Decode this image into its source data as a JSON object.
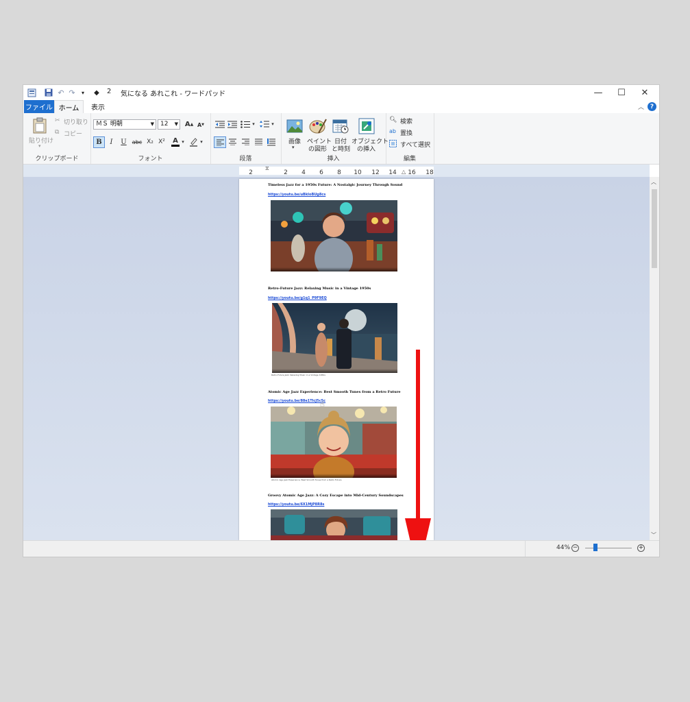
{
  "window": {
    "title_prefix": "2",
    "title": "気になる あれこれ - ワードパッド",
    "controls": {
      "minimize": "—",
      "maximize": "☐",
      "close": "✕"
    }
  },
  "tabs": [
    {
      "label": "ファイル"
    },
    {
      "label": "ホーム"
    },
    {
      "label": "表示"
    }
  ],
  "ribbon": {
    "clipboard": {
      "paste": "貼り付け",
      "cut": "切り取り",
      "copy": "コピー",
      "group": "クリップボード"
    },
    "font": {
      "family": "ＭＳ 明朝",
      "size": "12",
      "group": "フォント",
      "buttons": {
        "bold": "B",
        "italic": "I",
        "underline": "U",
        "strike": "abc",
        "subscript": "X₂",
        "superscript": "X²",
        "color": "A"
      }
    },
    "paragraph": {
      "group": "段落"
    },
    "insert": {
      "picture_l1": "画像",
      "paint_l1": "ペイント",
      "paint_l2": "の図形",
      "date_l1": "日付",
      "date_l2": "と時刻",
      "object_l1": "オブジェクト",
      "object_l2": "の挿入",
      "group": "挿入"
    },
    "edit": {
      "find": "検索",
      "replace": "置換",
      "select_all": "すべて選択",
      "group": "編集"
    }
  },
  "ruler": {
    "labels": [
      "2",
      "2",
      "4",
      "6",
      "8",
      "10",
      "12",
      "14",
      "16",
      "18"
    ]
  },
  "document": {
    "entries": [
      {
        "title": "Timeless Jazz for a 1950s Future: A Nostalgic Journey Through Sound",
        "link": "https://youtu.be/uBkIoBUg8cs",
        "caption": ""
      },
      {
        "title": "Retro-Future Jazz: Relaxing Music in a Vintage 1950s",
        "link": "https://youtu.be/g1q1_P9F9EQ",
        "caption": "Retro-Future Jazz: Relaxing Music in a Vintage 1950s"
      },
      {
        "title": "Atomic Age Jazz Experience: Best Smooth Tunes from a Retro Future",
        "link": "https://youtu.be/88e1TlcJ5c5c",
        "caption": "Atomic Age Jazz Experience: Best Smooth Tunes from a Retro Future"
      },
      {
        "title": "Groovy Atomic Age Jazz: A Cozy Escape into Mid-Century Soundscapes",
        "link": "https://youtu.be/6X1MjP8R8s",
        "caption": ""
      }
    ]
  },
  "status": {
    "zoom": "44%"
  },
  "colors": {
    "accent": "#1e6fcf",
    "arrow": "#ee1111",
    "link": "#1a4ad6"
  },
  "icons": [
    "save-icon",
    "undo-icon",
    "redo-icon",
    "paste-icon",
    "cut-icon",
    "copy-icon",
    "picture-icon",
    "paint-icon",
    "date-icon",
    "object-icon",
    "find-icon",
    "replace-icon",
    "select-all-icon",
    "zoom-out-icon",
    "zoom-in-icon"
  ]
}
